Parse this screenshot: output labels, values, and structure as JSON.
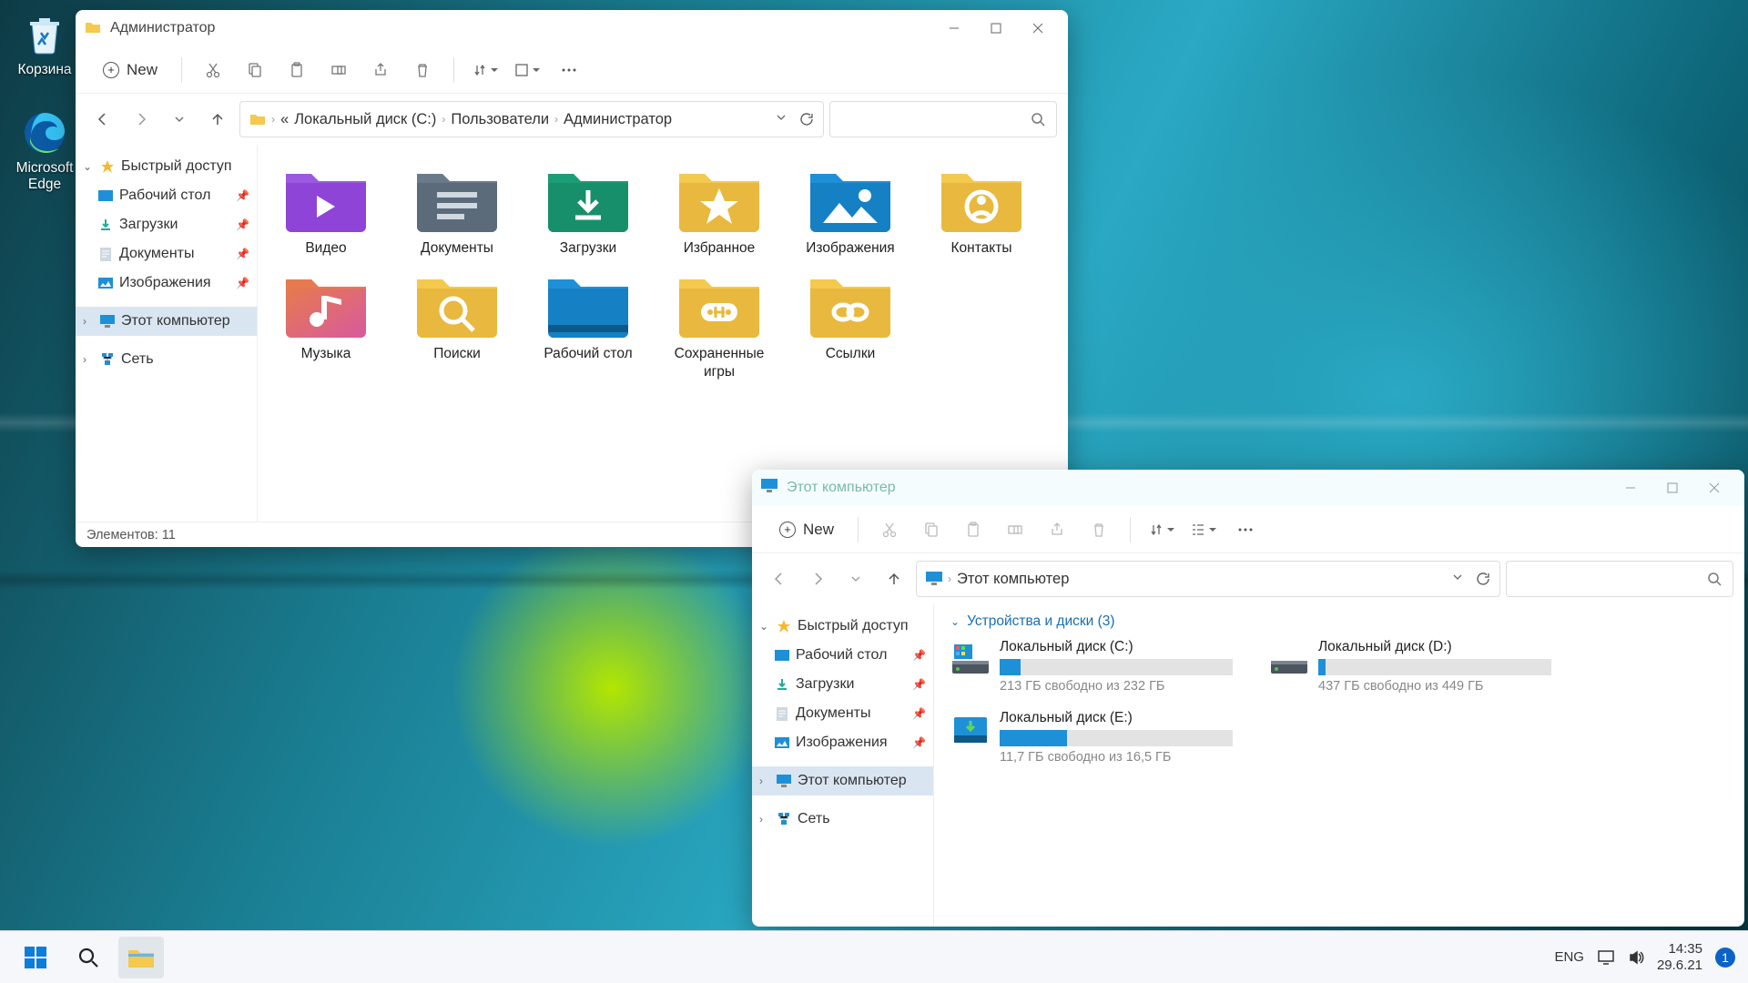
{
  "desktop": {
    "recycle": "Корзина",
    "edge": "Microsoft Edge"
  },
  "win1": {
    "title": "Администратор",
    "new": "New",
    "breadcrumb": [
      "Локальный диск (C:)",
      "Пользователи",
      "Администратор"
    ],
    "prefix": "«",
    "sidebar": {
      "quick": "Быстрый доступ",
      "items": [
        "Рабочий стол",
        "Загрузки",
        "Документы",
        "Изображения"
      ],
      "pc": "Этот компьютер",
      "net": "Сеть"
    },
    "folders": [
      "Видео",
      "Документы",
      "Загрузки",
      "Избранное",
      "Изображения",
      "Контакты",
      "Музыка",
      "Поиски",
      "Рабочий стол",
      "Сохраненные игры",
      "Ссылки"
    ],
    "status": "Элементов: 11"
  },
  "win2": {
    "title": "Этот компьютер",
    "new": "New",
    "addr": "Этот компьютер",
    "sidebar": {
      "quick": "Быстрый доступ",
      "items": [
        "Рабочий стол",
        "Загрузки",
        "Документы",
        "Изображения"
      ],
      "pc": "Этот компьютер",
      "net": "Сеть"
    },
    "group": "Устройства и диски (3)",
    "drives": [
      {
        "name": "Локальный диск (C:)",
        "free": "213 ГБ свободно из 232 ГБ",
        "pct": 9
      },
      {
        "name": "Локальный диск (D:)",
        "free": "437 ГБ свободно из 449 ГБ",
        "pct": 3
      },
      {
        "name": "Локальный диск (E:)",
        "free": "11,7 ГБ свободно из 16,5 ГБ",
        "pct": 29
      }
    ]
  },
  "taskbar": {
    "lang": "ENG",
    "time": "14:35",
    "date": "29.6.21",
    "notif": "1"
  }
}
